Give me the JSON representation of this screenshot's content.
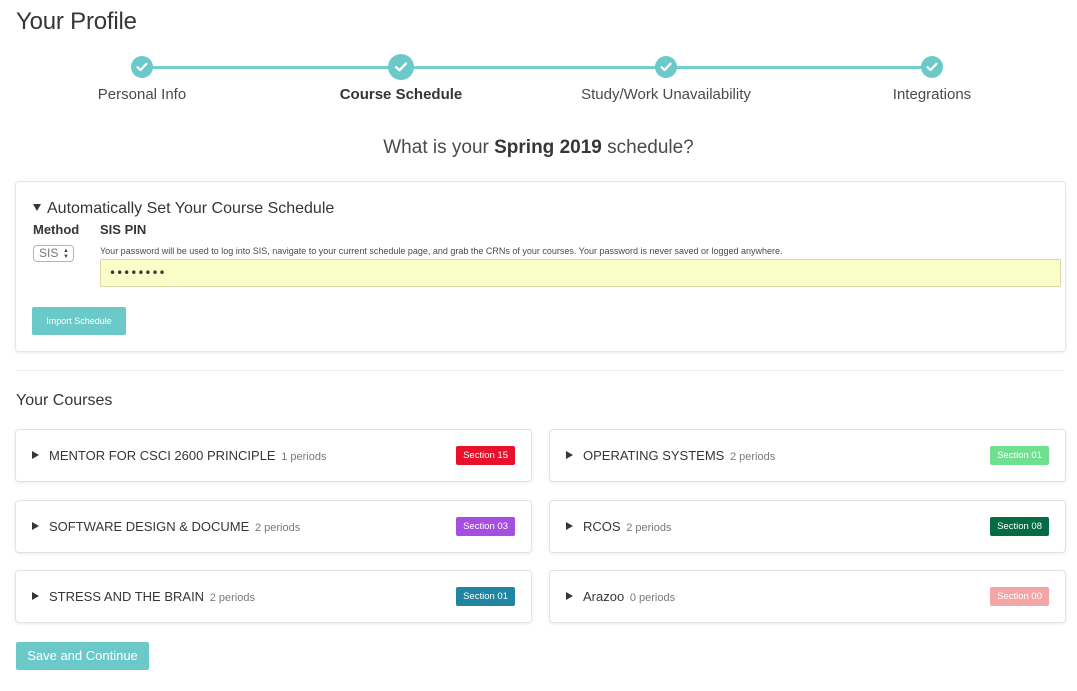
{
  "page": {
    "title": "Your Profile"
  },
  "stepper": {
    "accent": "#6cc9c9",
    "steps": [
      {
        "label": "Personal Info",
        "icon": "check-icon",
        "active": false
      },
      {
        "label": "Course Schedule",
        "icon": "check-icon",
        "active": true
      },
      {
        "label": "Study/Work Unavailability",
        "icon": "check-icon",
        "active": false
      },
      {
        "label": "Integrations",
        "icon": "check-icon",
        "active": false
      }
    ]
  },
  "question": {
    "prefix": "What is your ",
    "term": "Spring 2019",
    "suffix": " schedule?"
  },
  "auto_schedule": {
    "summary": "Automatically Set Your Course Schedule",
    "method_label": "Method",
    "method_value": "SIS",
    "pin_label": "SIS PIN",
    "pin_help": "Your password will be used to log into SIS, navigate to your current schedule page, and grab the CRNs of your courses. Your password is never saved or logged anywhere.",
    "pin_value": "••••••••",
    "import_label": "Import Schedule"
  },
  "courses": {
    "title": "Your Courses",
    "items": [
      {
        "name": "MENTOR FOR CSCI 2600 PRINCIPLE",
        "periods": "1 periods",
        "section": "Section 15",
        "color": "#e8102a"
      },
      {
        "name": "OPERATING SYSTEMS",
        "periods": "2 periods",
        "section": "Section 01",
        "color": "#6fe08f"
      },
      {
        "name": "SOFTWARE DESIGN & DOCUME",
        "periods": "2 periods",
        "section": "Section 03",
        "color": "#a64ee0"
      },
      {
        "name": "RCOS",
        "periods": "2 periods",
        "section": "Section 08",
        "color": "#046b44"
      },
      {
        "name": "STRESS AND THE BRAIN",
        "periods": "2 periods",
        "section": "Section 01",
        "color": "#1f85a0"
      },
      {
        "name": "Arazoo",
        "periods": "0 periods",
        "section": "Section 00",
        "color": "#f2a6a6"
      }
    ]
  },
  "footer": {
    "save_label": "Save and Continue"
  }
}
